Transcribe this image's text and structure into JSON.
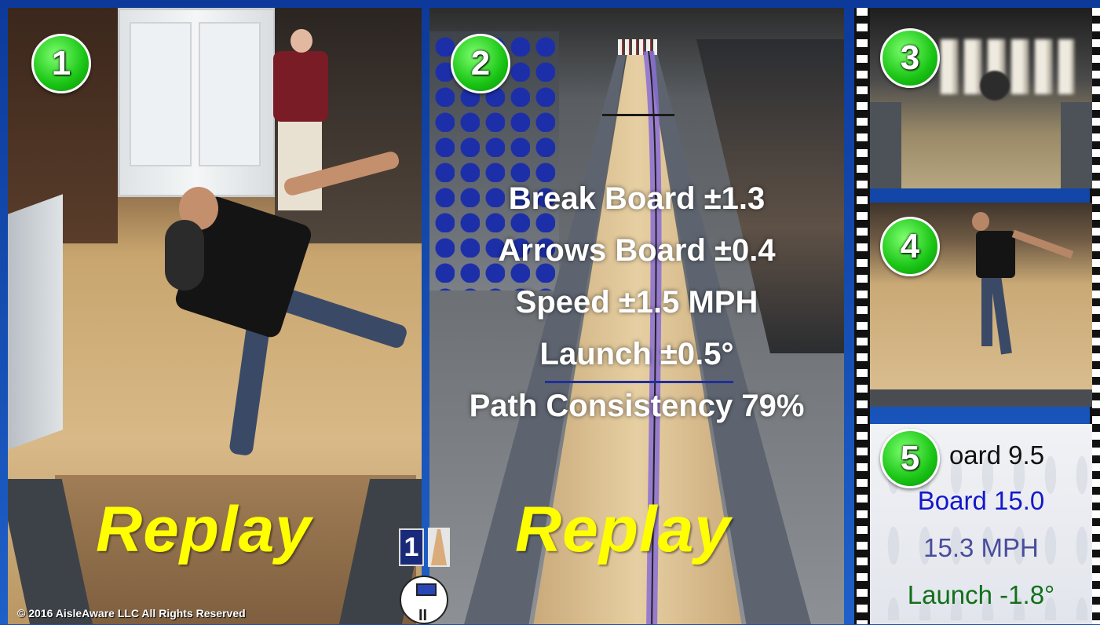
{
  "badges": [
    "1",
    "2",
    "3",
    "4",
    "5"
  ],
  "replay_label": "Replay",
  "stats": {
    "break_board": "Break Board ±1.3",
    "arrows_board": "Arrows Board ±0.4",
    "speed": "Speed ±1.5 MPH",
    "launch": "Launch ±0.5°",
    "path_consistency": "Path Consistency 79%"
  },
  "shot": {
    "line1": "oard 9.5",
    "line2": "Board 15.0",
    "line3": "15.3 MPH",
    "line4": "Launch -1.8°"
  },
  "controls": {
    "lane_number": "1",
    "pause_symbol": "II"
  },
  "copyright": "© 2016  AisleAware LLC  All Rights Reserved",
  "colors": {
    "replay": "#ffff00",
    "badge": "#19c414",
    "board_blue": "#1418c9",
    "speed_purple": "#4a4d9b",
    "launch_green": "#12701a"
  }
}
